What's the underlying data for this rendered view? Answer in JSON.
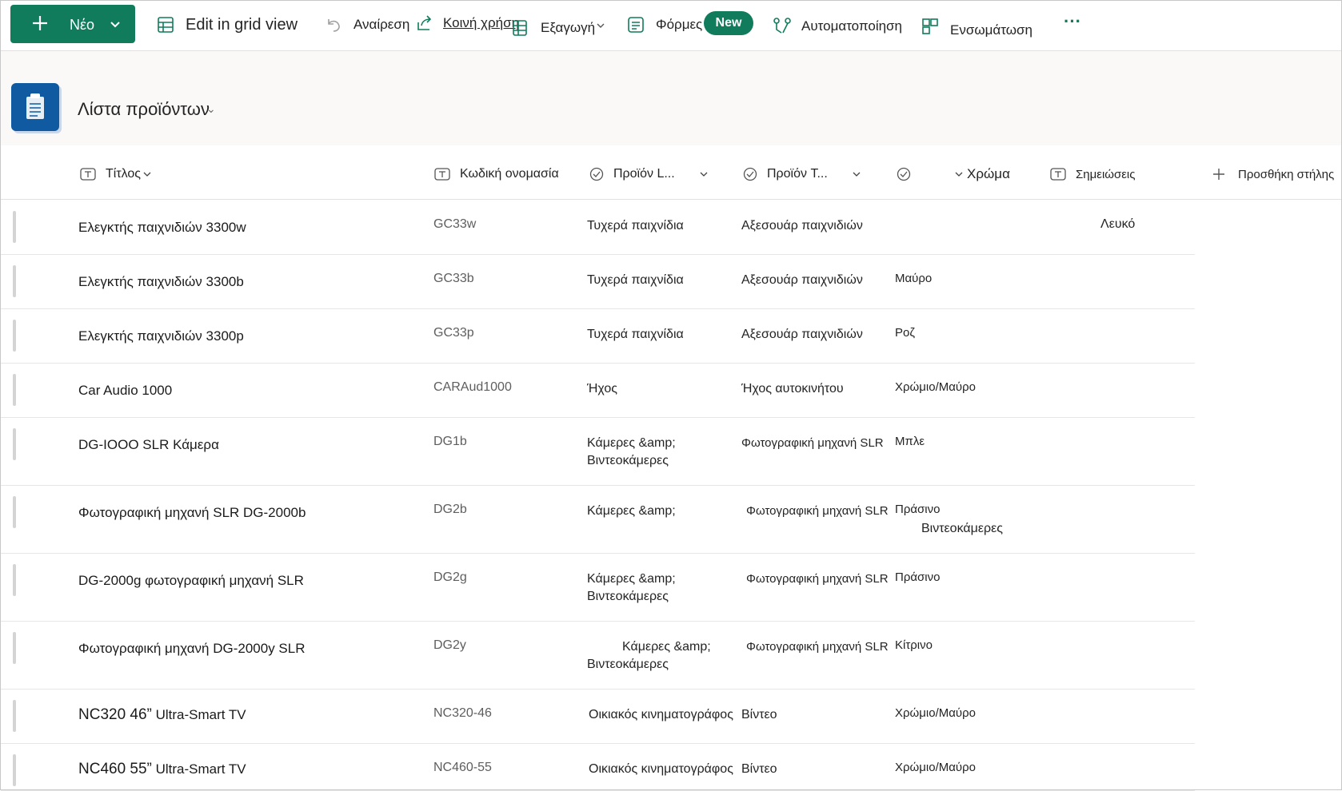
{
  "toolbar": {
    "new_label": "Νέο",
    "grid_view": "Edit in grid view",
    "undo": "Αναίρεση",
    "share": "Κοινή χρήση",
    "export": "Εξαγωγή",
    "forms": "Φόρμες",
    "new_badge": "New",
    "automate": "Αυτοματοποίηση",
    "integrate": "Ενσωμάτωση",
    "more": "···"
  },
  "list": {
    "title": "Λίστα προϊόντων"
  },
  "columns": {
    "title": "Τίτλος",
    "codename": "Κωδική ονομασία",
    "product_line": "Προϊόν L...",
    "product_type": "Προϊόν T...",
    "color": "Χρώμα",
    "notes": "Σημειώσεις",
    "add": "Προσθήκη στήλης"
  },
  "rows": [
    {
      "title": "Ελεγκτής παιχνιδιών 3300w",
      "title_main": "",
      "code": "GC33w",
      "line1": "Τυχερά παιχνίδια",
      "line2": "",
      "type": "Αξεσουάρ παιχνιδιών",
      "color": "",
      "notes": "Λευκό"
    },
    {
      "title": "Ελεγκτής παιχνιδιών 3300b",
      "title_main": "",
      "code": "GC33b",
      "line1": "Τυχερά παιχνίδια",
      "line2": "",
      "type": "Αξεσουάρ παιχνιδιών",
      "color": "Μαύρο",
      "notes": ""
    },
    {
      "title": "Ελεγκτής παιχνιδιών 3300p",
      "title_main": "",
      "code": "GC33p",
      "line1": "Τυχερά παιχνίδια",
      "line2": "",
      "type": "Αξεσουάρ παιχνιδιών",
      "color": "Ροζ",
      "notes": ""
    },
    {
      "title": "Car Audio 1000",
      "title_main": "",
      "code": "CARAud1000",
      "line1": "Ήχος",
      "line2": "",
      "type": "Ήχος αυτοκινήτου",
      "color": "Χρώμιο/Μαύρο",
      "notes": ""
    },
    {
      "title": "DG-IOOO SLR Κάμερα",
      "title_main": "",
      "code": "DG1b",
      "line1": "Κάμερες &amp;",
      "line2": "Βιντεοκάμερες",
      "type": "Φωτογραφική μηχανή SLR",
      "color": "Μπλε",
      "notes": ""
    },
    {
      "title": "Φωτογραφική μηχανή SLR DG-2000b",
      "title_main": "",
      "code": "DG2b",
      "line1": "Κάμερες &amp;",
      "line2": "",
      "type": "Φωτογραφική μηχανή SLR",
      "color": "Πράσινο",
      "notes": "",
      "extra": "Βιντεοκάμερες"
    },
    {
      "title": "DG-2000g φωτογραφική μηχανή SLR",
      "title_main": "",
      "code": "DG2g",
      "line1": "Κάμερες &amp;",
      "line2": "Βιντεοκάμερες",
      "type": "Φωτογραφική μηχανή SLR",
      "color": "Πράσινο",
      "notes": ""
    },
    {
      "title": "Φωτογραφική μηχανή DG-2000y SLR",
      "title_main": "",
      "code": "DG2y",
      "line1": "Κάμερες &amp;",
      "line2": "Βιντεοκάμερες",
      "type": "Φωτογραφική μηχανή SLR",
      "color": "Κίτρινο",
      "notes": ""
    },
    {
      "title": " Ultra-Smart TV",
      "title_main": "NC320 46”",
      "code": "NC320-46",
      "line1": "Οικιακός κινηματογράφος",
      "line2": "",
      "type": "Βίντεο",
      "color": "Χρώμιο/Μαύρο",
      "notes": ""
    },
    {
      "title": " Ultra-Smart TV",
      "title_main": "NC460 55”",
      "code": "NC460-55",
      "line1": "Οικιακός κινηματογράφος",
      "line2": "",
      "type": "Βίντεο",
      "color": "Χρώμιο/Μαύρο",
      "notes": ""
    }
  ],
  "colors": {
    "accent": "#107c5b",
    "list_icon": "#0f5aa0"
  }
}
